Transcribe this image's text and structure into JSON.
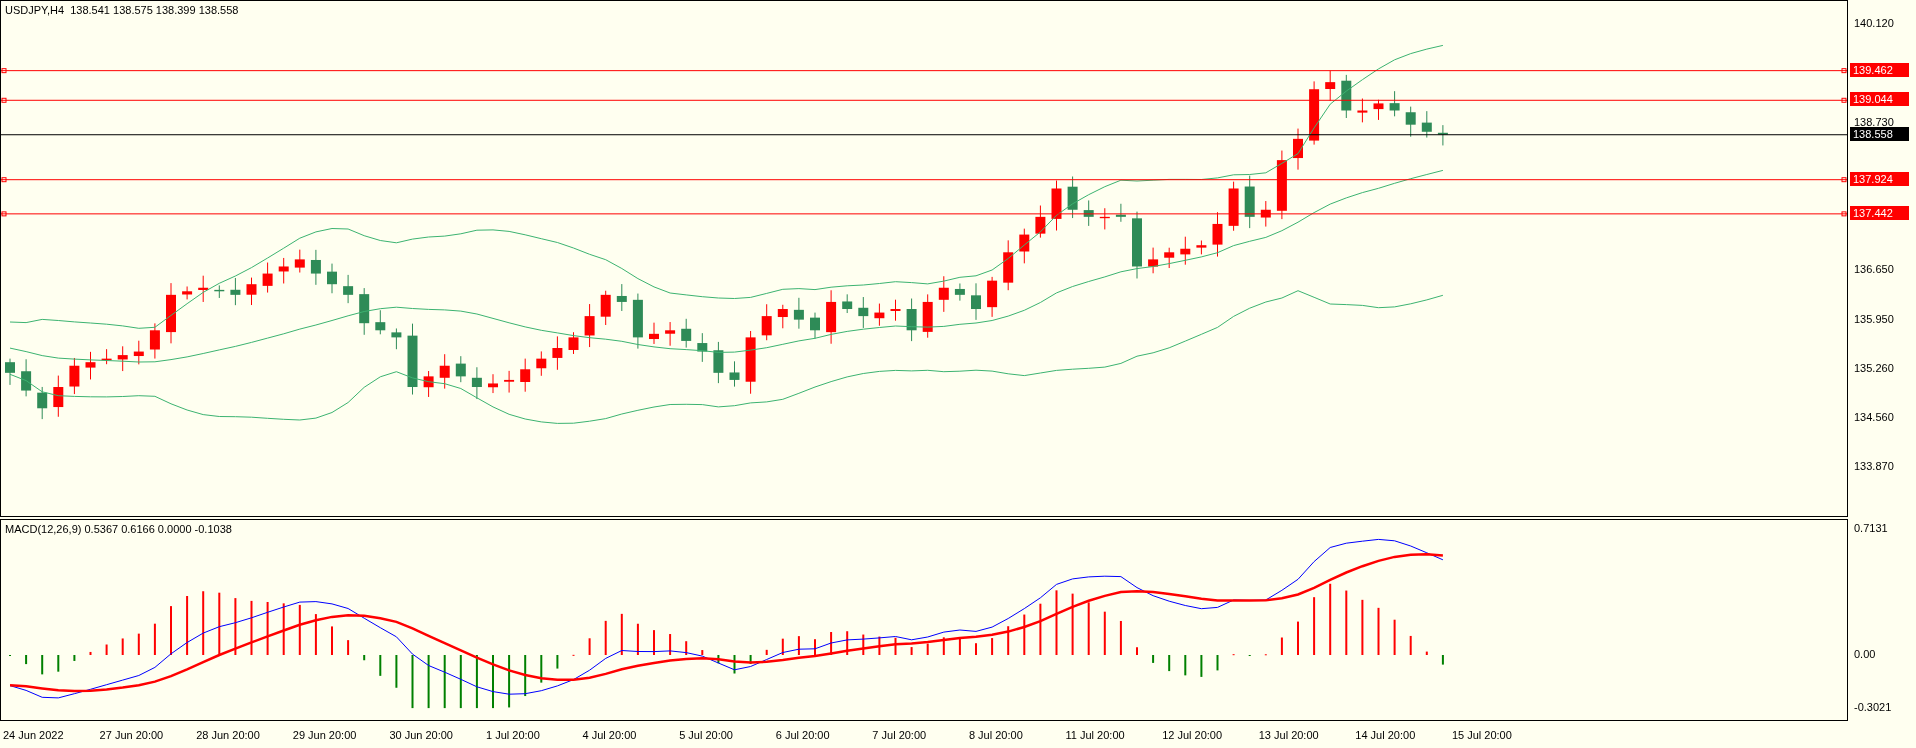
{
  "chart": {
    "symbol": "USDJPY,H4",
    "ohlc": [
      "138.541",
      "138.575",
      "138.399",
      "138.558"
    ],
    "price_axis": [
      "140.120",
      "138.730",
      "136.650",
      "135.950",
      "135.260",
      "134.560",
      "133.870"
    ],
    "levels": [
      {
        "label": "139.462",
        "kind": "line"
      },
      {
        "label": "139.044",
        "kind": "line"
      },
      {
        "label": "138.558",
        "kind": "bid"
      },
      {
        "label": "137.924",
        "kind": "line"
      },
      {
        "label": "137.442",
        "kind": "line"
      }
    ]
  },
  "macd": {
    "title": "MACD(12,26,9)",
    "values": [
      "0.5367",
      "0.6166",
      "0.0000",
      "-0.1038"
    ],
    "axis": [
      "0.7131",
      "0.00",
      "-0.3021"
    ]
  },
  "time_axis": [
    "24 Jun 2022",
    "27 Jun 20:00",
    "28 Jun 20:00",
    "29 Jun 20:00",
    "30 Jun 20:00",
    "1 Jul 20:00",
    "4 Jul 20:00",
    "5 Jul 20:00",
    "6 Jul 20:00",
    "7 Jul 20:00",
    "8 Jul 20:00",
    "11 Jul 20:00",
    "12 Jul 20:00",
    "13 Jul 20:00",
    "14 Jul 20:00",
    "15 Jul 20:00"
  ]
}
